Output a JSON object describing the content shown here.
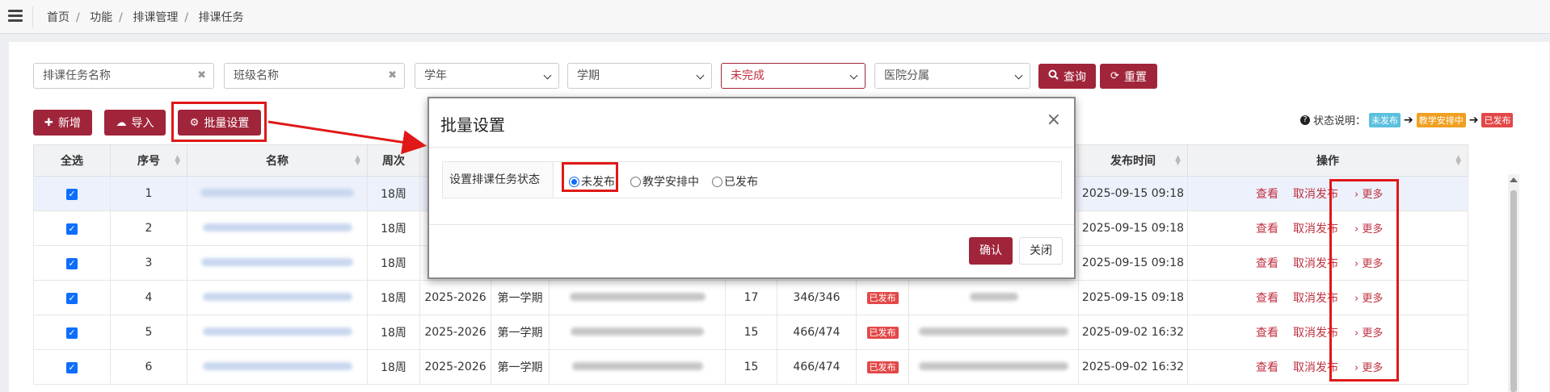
{
  "breadcrumb": [
    "首页",
    "功能",
    "排课管理",
    "排课任务"
  ],
  "filters": {
    "task_name_placeholder": "排课任务名称",
    "class_name_placeholder": "班级名称",
    "year": "学年",
    "term": "学期",
    "status": "未完成",
    "hospital": "医院分属",
    "clear_icon": "✖"
  },
  "buttons": {
    "query": "查询",
    "reset": "重置",
    "add": "新增",
    "import": "导入",
    "batch": "批量设置"
  },
  "legend": {
    "label": "状态说明：",
    "tags": [
      {
        "text": "未发布",
        "color": "#5bc0de"
      },
      {
        "text": "教学安排中",
        "color": "#f0a020"
      },
      {
        "text": "已发布",
        "color": "#e34848"
      }
    ]
  },
  "table": {
    "headers": [
      "全选",
      "序号",
      "名称",
      "周次",
      "",
      "",
      "",
      "",
      "",
      "",
      "",
      "发布时间",
      "操作"
    ],
    "rows": [
      {
        "no": "1",
        "week": "18周",
        "year": "",
        "term": "",
        "count": "",
        "ratio": "",
        "status": "",
        "time": "2025-09-15 09:18",
        "ratio_green": false
      },
      {
        "no": "2",
        "week": "18周",
        "year": "",
        "term": "",
        "count": "",
        "ratio": "",
        "status": "",
        "time": "2025-09-15 09:18",
        "ratio_green": false
      },
      {
        "no": "3",
        "week": "18周",
        "year": "",
        "term": "",
        "count": "",
        "ratio": "",
        "status": "",
        "time": "2025-09-15 09:18",
        "ratio_green": false
      },
      {
        "no": "4",
        "week": "18周",
        "year": "2025-2026",
        "term": "第一学期",
        "count": "17",
        "ratio": "346/346",
        "status": "已发布",
        "time": "2025-09-15 09:18",
        "ratio_green": true
      },
      {
        "no": "5",
        "week": "18周",
        "year": "2025-2026",
        "term": "第一学期",
        "count": "15",
        "ratio": "466/474",
        "status": "已发布",
        "time": "2025-09-02 16:32",
        "ratio_green": false
      },
      {
        "no": "6",
        "week": "18周",
        "year": "2025-2026",
        "term": "第一学期",
        "count": "15",
        "ratio": "466/474",
        "status": "已发布",
        "time": "2025-09-02 16:32",
        "ratio_green": false
      }
    ],
    "actions": {
      "view": "查看",
      "cancel": "取消发布",
      "more": "› 更多"
    }
  },
  "modal": {
    "title": "批量设置",
    "close_icon": "×",
    "field_label": "设置排课任务状态",
    "options": [
      "未发布",
      "教学安排中",
      "已发布"
    ],
    "selected": "未发布",
    "confirm": "确认",
    "close": "关闭"
  }
}
